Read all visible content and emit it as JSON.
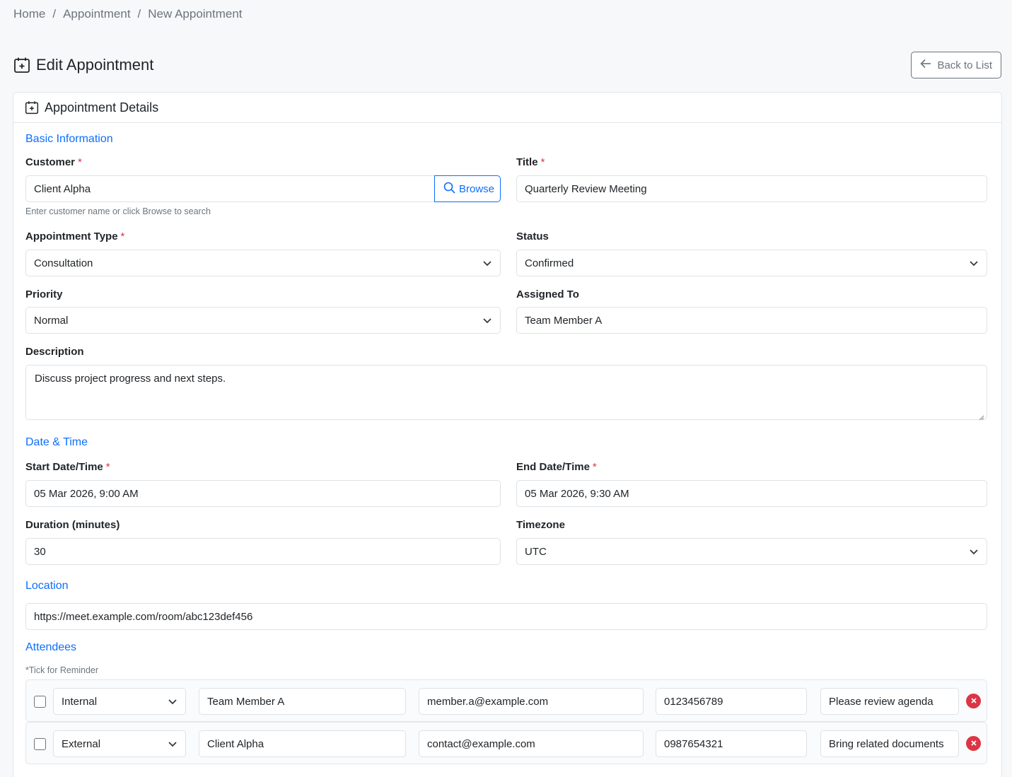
{
  "breadcrumb": {
    "home": "Home",
    "appointment": "Appointment",
    "current": "New Appointment",
    "separator": "/"
  },
  "header": {
    "title": "Edit Appointment",
    "back_label": "Back to List"
  },
  "card": {
    "title": "Appointment Details"
  },
  "basic": {
    "section_title": "Basic Information",
    "customer": {
      "label": "Customer",
      "required": "*",
      "value": "Client Alpha",
      "browse_label": "Browse",
      "help": "Enter customer name or click Browse to search"
    },
    "title": {
      "label": "Title",
      "required": "*",
      "value": "Quarterly Review Meeting"
    },
    "type": {
      "label": "Appointment Type",
      "required": "*",
      "value": "Consultation"
    },
    "status": {
      "label": "Status",
      "value": "Confirmed"
    },
    "priority": {
      "label": "Priority",
      "value": "Normal"
    },
    "assigned": {
      "label": "Assigned To",
      "value": "Team Member A"
    },
    "description": {
      "label": "Description",
      "value": "Discuss project progress and next steps."
    }
  },
  "datetime": {
    "section_title": "Date & Time",
    "start": {
      "label": "Start Date/Time",
      "required": "*",
      "value": "05 Mar 2026, 9:00 AM"
    },
    "end": {
      "label": "End Date/Time",
      "required": "*",
      "value": "05 Mar 2026, 9:30 AM"
    },
    "duration": {
      "label": "Duration (minutes)",
      "value": "30"
    },
    "timezone": {
      "label": "Timezone",
      "value": "UTC"
    }
  },
  "location": {
    "section_title": "Location",
    "value": "https://meet.example.com/room/abc123def456"
  },
  "attendees": {
    "section_title": "Attendees",
    "note": "*Tick for Reminder",
    "rows": [
      {
        "type": "Internal",
        "name": "Team Member A",
        "email": "member.a@example.com",
        "phone": "0123456789",
        "note": "Please review agenda"
      },
      {
        "type": "External",
        "name": "Client Alpha",
        "email": "contact@example.com",
        "phone": "0987654321",
        "note": "Bring related documents"
      }
    ]
  },
  "colors": {
    "accent": "#0d6efd",
    "danger": "#dc3545",
    "border": "#dee2e6",
    "muted": "#6c757d"
  }
}
